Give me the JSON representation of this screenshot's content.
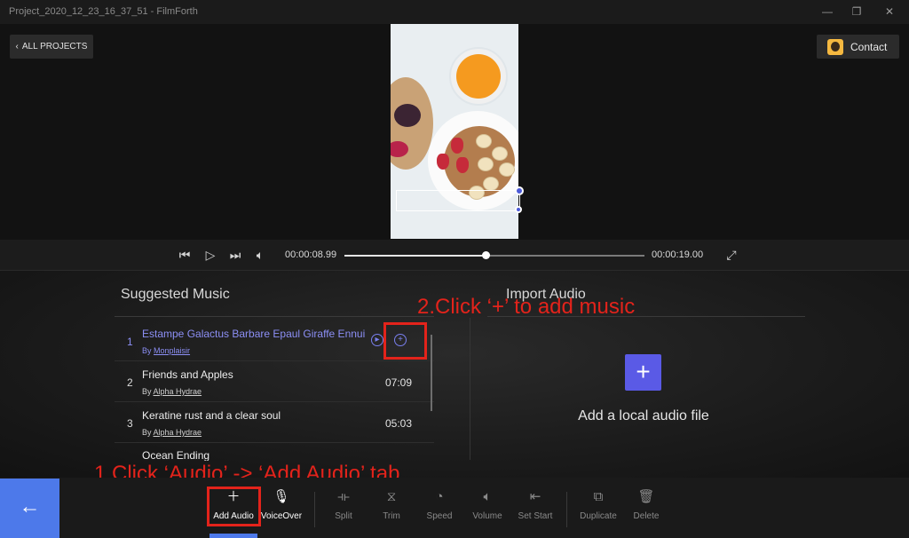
{
  "window": {
    "title": "Project_2020_12_23_16_37_51 - FilmForth",
    "min": "—",
    "restore": "❐",
    "close": "✕"
  },
  "header": {
    "all_projects": "ALL PROJECTS",
    "contact": "Contact"
  },
  "player": {
    "current_time": "00:00:08.99",
    "total_time": "00:00:19.00",
    "progress": 0.47,
    "icons": [
      "skip-back-icon",
      "play-icon",
      "skip-forward-icon",
      "volume-icon",
      "fullscreen-icon"
    ]
  },
  "suggested": {
    "title": "Suggested Music",
    "tracks": [
      {
        "num": "1",
        "name": "Estampe Galactus Barbare Epaul Giraffe Ennui",
        "by_prefix": "By",
        "artist": "Monplaisir",
        "duration": ""
      },
      {
        "num": "2",
        "name": "Friends and Apples",
        "by_prefix": "By",
        "artist": "Alpha Hydrae",
        "duration": "07:09"
      },
      {
        "num": "3",
        "name": "Keratine rust and a clear soul",
        "by_prefix": "By",
        "artist": "Alpha Hydrae",
        "duration": "05:03"
      },
      {
        "num": "",
        "name": "Ocean Ending",
        "by_prefix": "",
        "artist": "",
        "duration": ""
      }
    ]
  },
  "import": {
    "title": "Import Audio",
    "add_label": "Add a local audio file"
  },
  "annotations": {
    "step1": "1.Click ‘Audio’ -> ‘Add Audio’ tab",
    "step2": "2.Click ‘+’ to add music"
  },
  "toolbar": {
    "back_icon": "arrow-left-icon",
    "items": [
      {
        "label": "Add Audio",
        "icon": "plus-icon"
      },
      {
        "label": "VoiceOver",
        "icon": "microphone-icon"
      },
      {
        "label": "Split",
        "icon": "split-icon"
      },
      {
        "label": "Trim",
        "icon": "trim-icon"
      },
      {
        "label": "Speed",
        "icon": "speed-icon"
      },
      {
        "label": "Volume",
        "icon": "volume-icon"
      },
      {
        "label": "Set Start",
        "icon": "set-start-icon"
      },
      {
        "label": "Duplicate",
        "icon": "duplicate-icon"
      },
      {
        "label": "Delete",
        "icon": "trash-icon"
      }
    ]
  },
  "colors": {
    "accent": "#4d79ea",
    "highlight": "#8c8ff5",
    "annotation": "#e3231b"
  }
}
